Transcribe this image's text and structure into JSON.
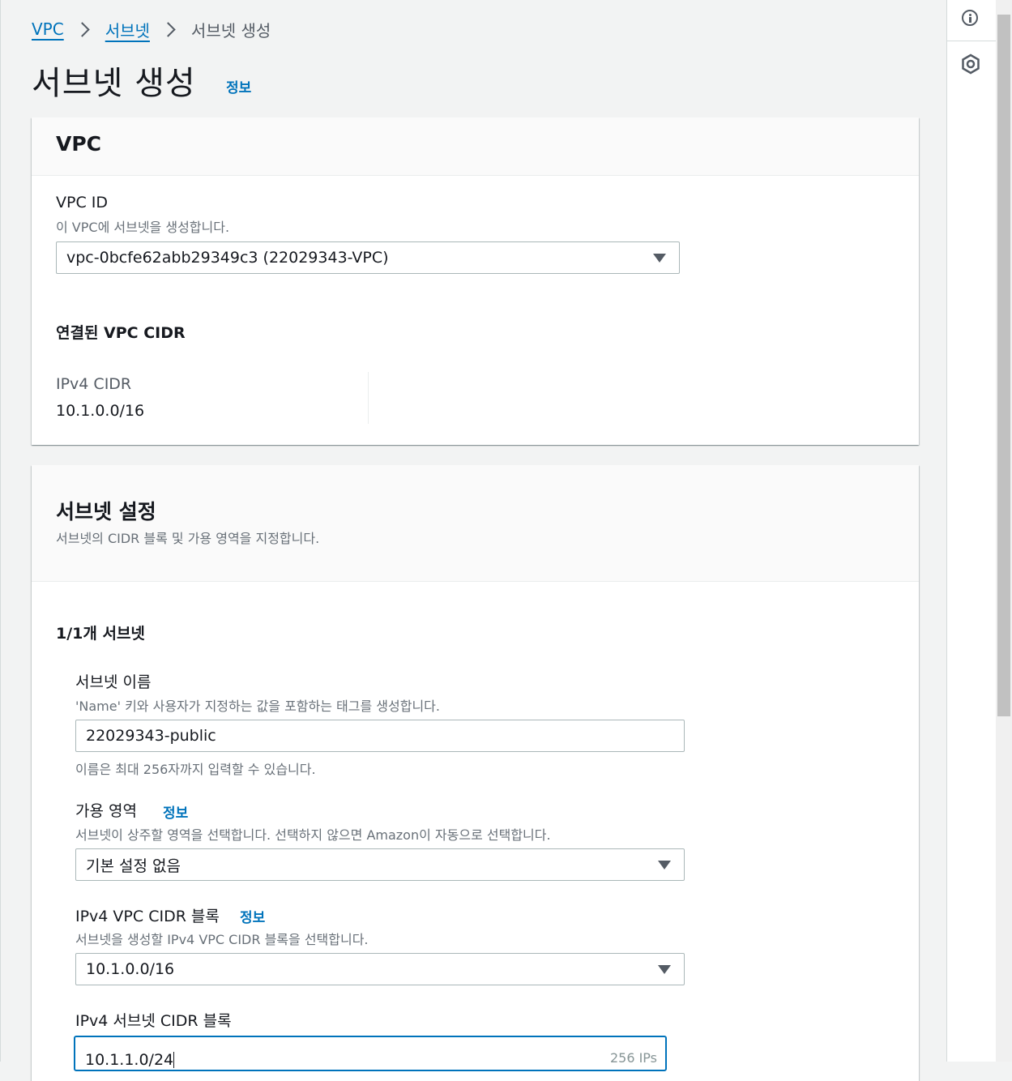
{
  "breadcrumb": {
    "items": [
      "VPC",
      "서브넷"
    ],
    "current": "서브넷 생성"
  },
  "page": {
    "title": "서브넷 생성",
    "info_link": "정보"
  },
  "vpc_panel": {
    "title": "VPC",
    "vpc_id_label": "VPC ID",
    "vpc_id_desc": "이 VPC에 서브넷을 생성합니다.",
    "vpc_id_value": "vpc-0bcfe62abb29349c3 (22029343-VPC)",
    "associated_cidr_title": "연결된 VPC CIDR",
    "ipv4_cidr_label": "IPv4 CIDR",
    "ipv4_cidr_value": "10.1.0.0/16"
  },
  "subnet_panel": {
    "title": "서브넷 설정",
    "desc": "서브넷의 CIDR 블록 및 가용 영역을 지정합니다.",
    "count": "1/1개 서브넷",
    "name_label": "서브넷 이름",
    "name_desc": "'Name' 키와 사용자가 지정하는 값을 포함하는 태그를 생성합니다.",
    "name_value": "22029343-public",
    "name_hint": "이름은 최대 256자까지 입력할 수 있습니다.",
    "az_label": "가용 영역",
    "az_info": "정보",
    "az_desc": "서브넷이 상주할 영역을 선택합니다. 선택하지 않으면 Amazon이 자동으로 선택합니다.",
    "az_value": "기본 설정 없음",
    "vpc_cidr_label": "IPv4 VPC CIDR 블록",
    "vpc_cidr_info": "정보",
    "vpc_cidr_desc": "서브넷을 생성할 IPv4 VPC CIDR 블록을 선택합니다.",
    "vpc_cidr_value": "10.1.0.0/16",
    "subnet_cidr_label": "IPv4 서브넷 CIDR 블록",
    "subnet_cidr_value": "10.1.1.0/24",
    "subnet_cidr_ips": "256 IPs"
  },
  "rail": {
    "icons": [
      "info-icon",
      "settings-hex-icon"
    ]
  },
  "colors": {
    "link": "#0073bb",
    "text": "#16191f",
    "muted": "#687078",
    "border": "#aab7b8"
  }
}
